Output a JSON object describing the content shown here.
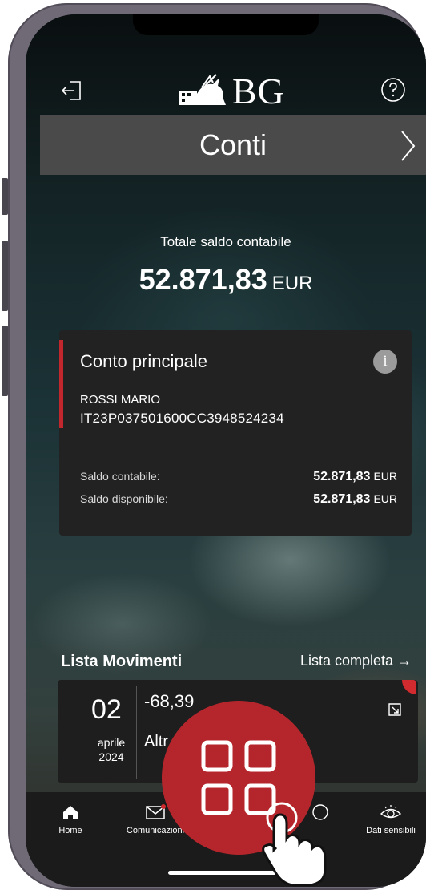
{
  "header": {
    "logo_text": "BG",
    "title": "Conti"
  },
  "summary": {
    "label": "Totale saldo contabile",
    "amount": "52.871,83",
    "currency": "EUR"
  },
  "account": {
    "name": "Conto principale",
    "info_glyph": "i",
    "holder": "ROSSI MARIO",
    "iban": "IT23P037501600CC3948524234",
    "rows": [
      {
        "label": "Saldo contabile:",
        "amount": "52.871,83",
        "currency": "EUR"
      },
      {
        "label": "Saldo disponibile:",
        "amount": "52.871,83",
        "currency": "EUR"
      }
    ]
  },
  "movements": {
    "title": "Lista Movimenti",
    "link": "Lista completa →",
    "item": {
      "day": "02",
      "month": "aprile",
      "year": "2024",
      "amount": "-68,39",
      "desc": "Altr"
    }
  },
  "nav": {
    "items": [
      {
        "label": "Home",
        "icon": "home-icon"
      },
      {
        "label": "Comunicazioni",
        "icon": "mail-icon"
      },
      {
        "label": "",
        "icon": "profile-icon"
      },
      {
        "label": "Dati sensibili",
        "icon": "eye-icon"
      }
    ]
  },
  "colors": {
    "brand_red": "#b5262c",
    "card": "#222222",
    "titlebar": "#4a4a4a"
  }
}
